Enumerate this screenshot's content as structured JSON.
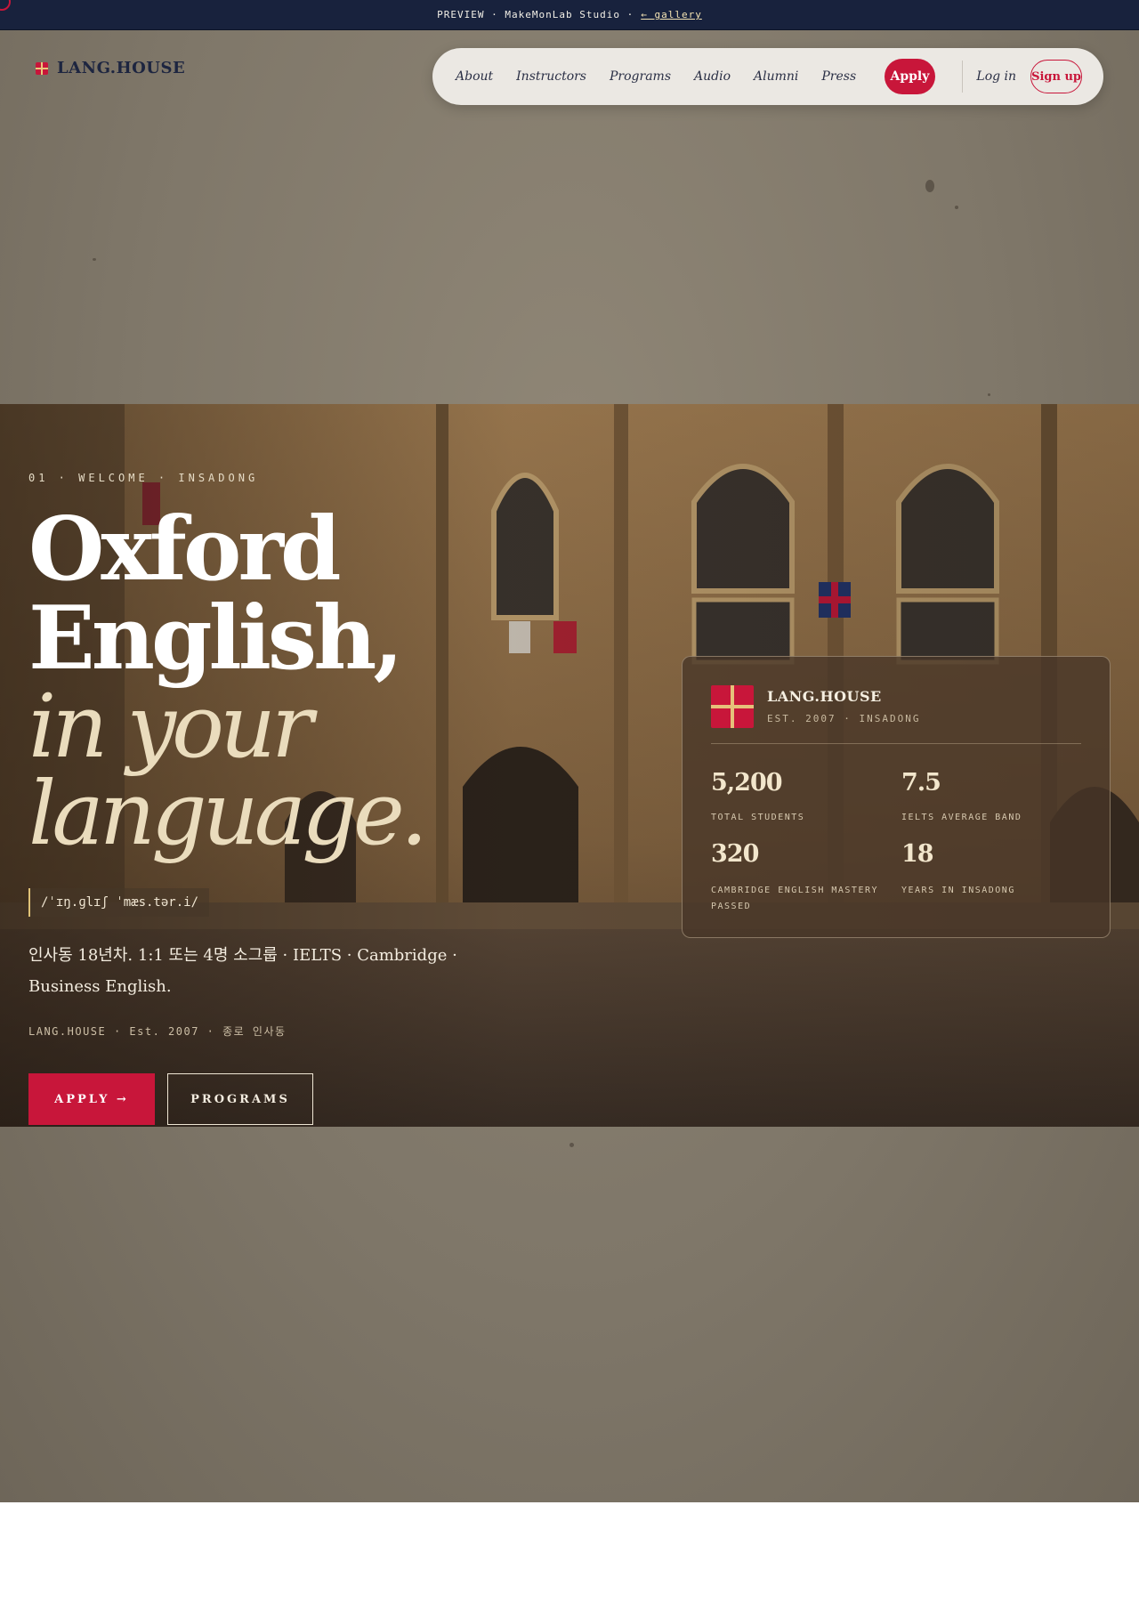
{
  "preview_bar": {
    "text": "PREVIEW · MakeMonLab Studio ·",
    "link": "← gallery"
  },
  "brand": {
    "name": "LANG.HOUSE"
  },
  "nav": {
    "links": [
      "About",
      "Instructors",
      "Programs",
      "Audio",
      "Alumni",
      "Press"
    ],
    "apply": "Apply",
    "login": "Log in",
    "signup": "Sign up"
  },
  "hero": {
    "eyebrow": "01 · WELCOME · INSADONG",
    "headline_line1": "Oxford",
    "headline_line2": "English,",
    "headline_line3": "in your",
    "headline_line4": "language.",
    "phonetic": "/ˈɪŋ.ɡlɪʃ ˈmæs.tər.i/",
    "subtitle": "인사동 18년차. 1:1 또는 4명 소그룹 · IELTS · Cambridge · Business English.",
    "meta": "LANG.HOUSE · Est. 2007 · 종로 인사동",
    "apply_button": "APPLY →",
    "programs_button": "PROGRAMS"
  },
  "card": {
    "title": "LANG.HOUSE",
    "subtitle": "EST. 2007 · INSADONG",
    "stats": [
      {
        "value": "5,200",
        "label": "TOTAL STUDENTS"
      },
      {
        "value": "7.5",
        "label": "IELTS AVERAGE BAND"
      },
      {
        "value": "320",
        "label": "CAMBRIDGE ENGLISH MASTERY PASSED"
      },
      {
        "value": "18",
        "label": "YEARS IN INSADONG"
      }
    ]
  },
  "colors": {
    "brand_red": "#c8163a",
    "navy": "#18223d",
    "gold": "#e6c07a"
  }
}
